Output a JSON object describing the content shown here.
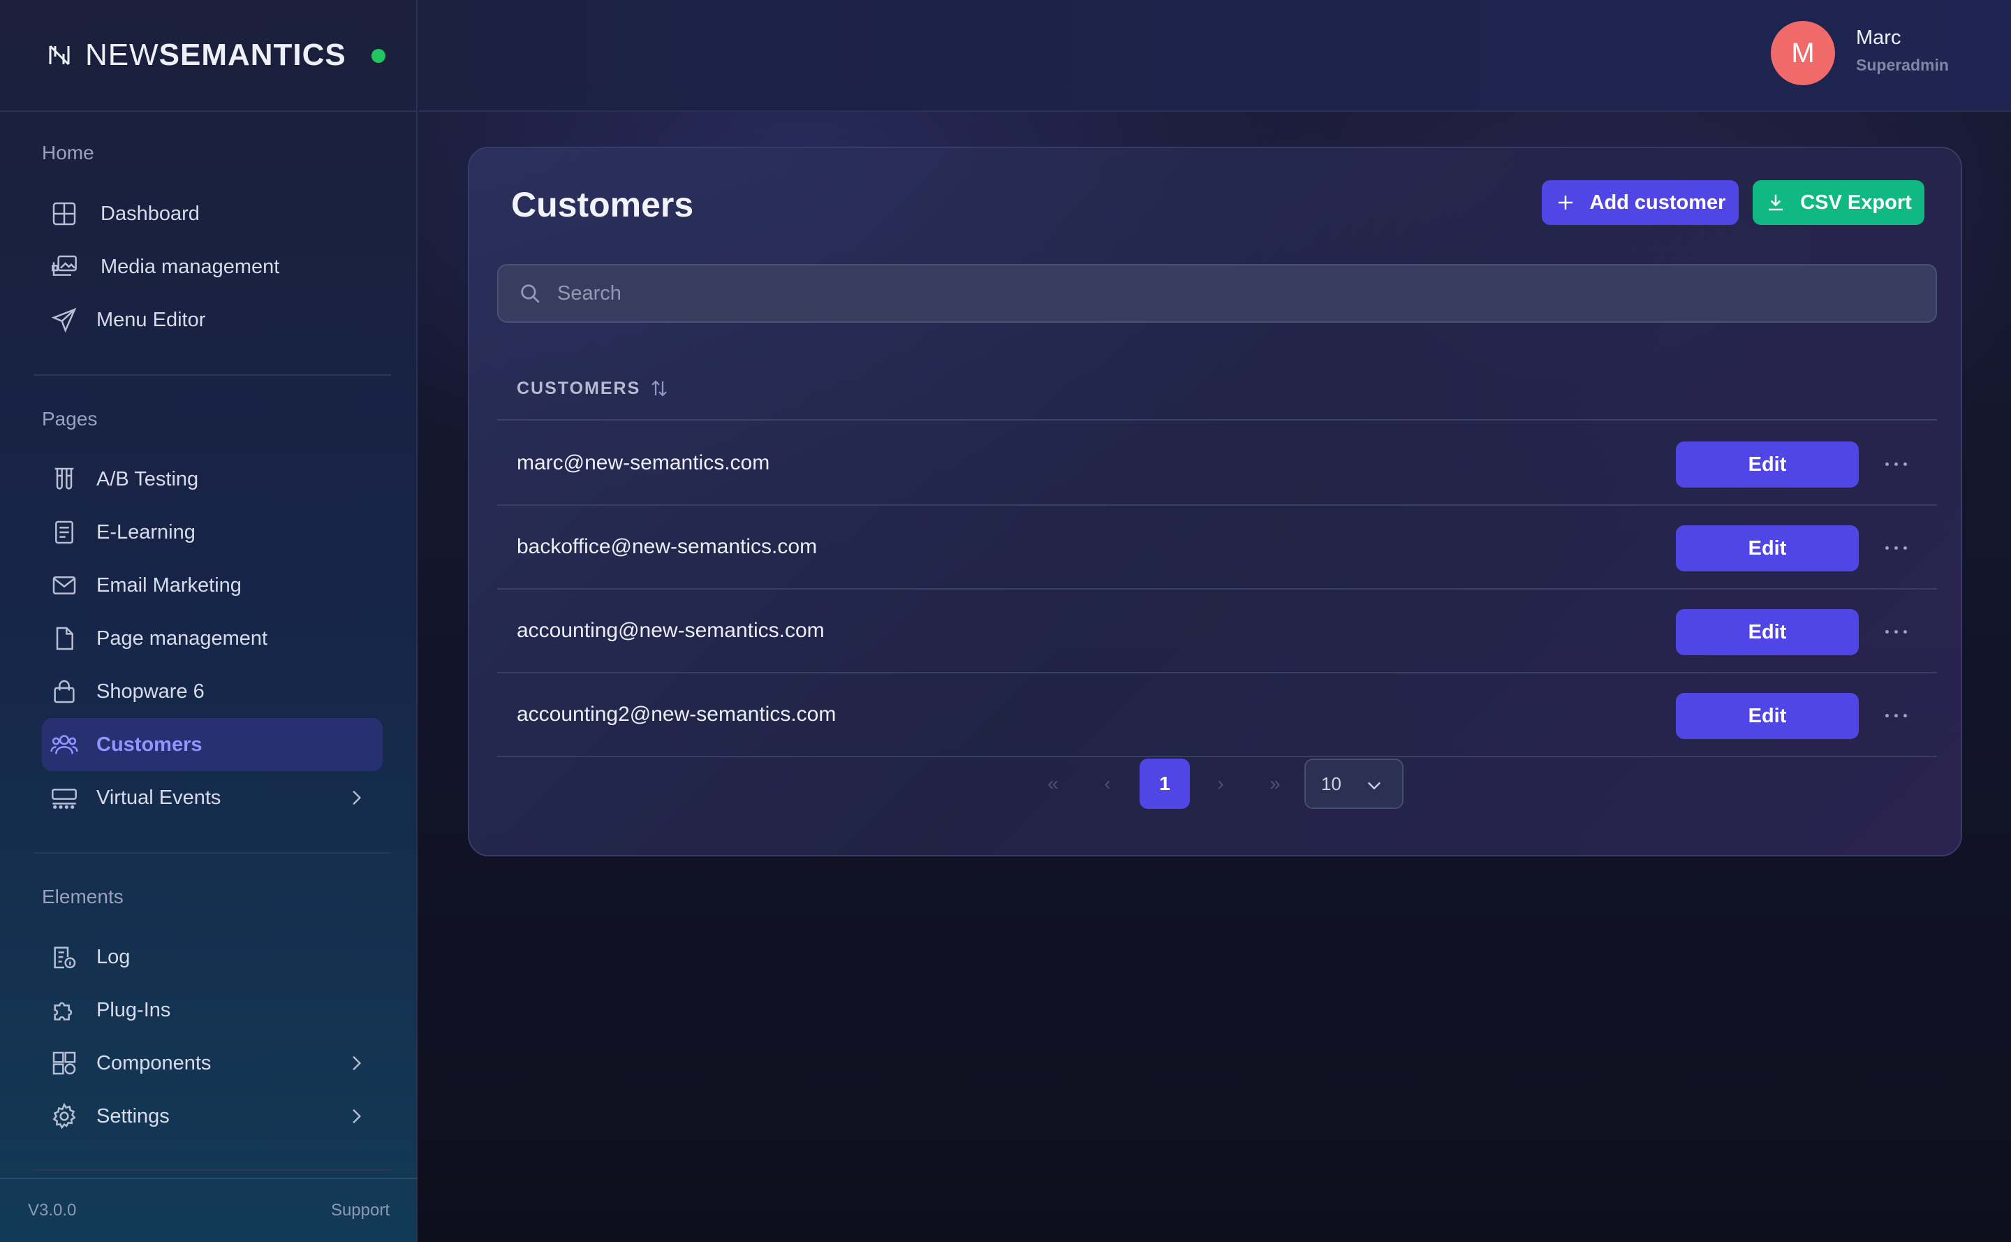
{
  "brand": {
    "name_thin": "NEW",
    "name_bold": "SEMANTICS",
    "status_color": "#22c55e"
  },
  "sidebar": {
    "sections": [
      {
        "title": "Home"
      },
      {
        "title": "Pages"
      },
      {
        "title": "Elements"
      }
    ],
    "home_items": [
      {
        "label": "Dashboard",
        "icon": "grid-icon"
      },
      {
        "label": "Media management",
        "icon": "images-icon"
      },
      {
        "label": "Menu Editor",
        "icon": "send-icon"
      }
    ],
    "page_items": [
      {
        "label": "A/B Testing",
        "icon": "test-tubes-icon"
      },
      {
        "label": "E-Learning",
        "icon": "book-icon"
      },
      {
        "label": "Email Marketing",
        "icon": "mail-icon"
      },
      {
        "label": "Page management",
        "icon": "file-icon"
      },
      {
        "label": "Shopware 6",
        "icon": "shopping-bag-icon"
      },
      {
        "label": "Customers",
        "icon": "users-icon",
        "active": true
      },
      {
        "label": "Virtual Events",
        "icon": "events-icon",
        "has_children": true
      }
    ],
    "element_items": [
      {
        "label": "Log",
        "icon": "log-icon"
      },
      {
        "label": "Plug-Ins",
        "icon": "puzzle-icon"
      },
      {
        "label": "Components",
        "icon": "components-icon",
        "has_children": true
      },
      {
        "label": "Settings",
        "icon": "gear-icon",
        "has_children": true
      }
    ],
    "footer": {
      "version": "V3.0.0",
      "support": "Support"
    }
  },
  "user": {
    "initial": "M",
    "name": "Marc",
    "role": "Superadmin",
    "avatar_color": "#f06a6a"
  },
  "main": {
    "title": "Customers",
    "add_button": "Add customer",
    "export_button": "CSV Export",
    "search_placeholder": "Search",
    "column_header": "CUSTOMERS",
    "rows": [
      {
        "email": "marc@new-semantics.com",
        "action": "Edit"
      },
      {
        "email": "backoffice@new-semantics.com",
        "action": "Edit"
      },
      {
        "email": "accounting@new-semantics.com",
        "action": "Edit"
      },
      {
        "email": "accounting2@new-semantics.com",
        "action": "Edit"
      }
    ],
    "pagination": {
      "first": "«",
      "prev": "‹",
      "current_page": "1",
      "next": "›",
      "last": "»",
      "page_size": "10"
    }
  },
  "colors": {
    "primary": "#4f46e5",
    "success": "#10b981",
    "active_nav_text": "#8f96ff"
  }
}
